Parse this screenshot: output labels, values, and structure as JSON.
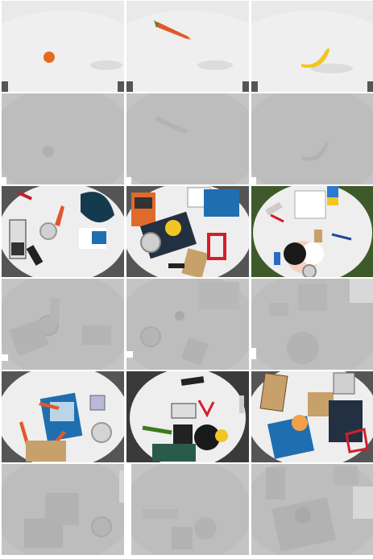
{
  "grid": {
    "columns": 3,
    "rows": 6,
    "cells": [
      {
        "kind": "rgb",
        "scene": "orange"
      },
      {
        "kind": "rgb",
        "scene": "carrot"
      },
      {
        "kind": "rgb",
        "scene": "banana"
      },
      {
        "kind": "depth",
        "scene": "orange"
      },
      {
        "kind": "depth",
        "scene": "carrot"
      },
      {
        "kind": "depth",
        "scene": "banana"
      },
      {
        "kind": "rgb",
        "scene": "clutter-a"
      },
      {
        "kind": "rgb",
        "scene": "clutter-b"
      },
      {
        "kind": "rgb",
        "scene": "clutter-c"
      },
      {
        "kind": "depth",
        "scene": "clutter-a"
      },
      {
        "kind": "depth",
        "scene": "clutter-b"
      },
      {
        "kind": "depth",
        "scene": "clutter-c"
      },
      {
        "kind": "rgb",
        "scene": "clutter-d"
      },
      {
        "kind": "rgb",
        "scene": "clutter-e"
      },
      {
        "kind": "rgb",
        "scene": "clutter-f"
      },
      {
        "kind": "depth",
        "scene": "clutter-d"
      },
      {
        "kind": "depth",
        "scene": "clutter-e"
      },
      {
        "kind": "depth",
        "scene": "clutter-f"
      }
    ]
  },
  "colors": {
    "table_white": "#eeeeee",
    "floor_dark": "#4a4a4a",
    "depth_bg": "#c4c4c4",
    "depth_table": "#bdbdbd",
    "depth_object": "#b0b0b0",
    "orange": "#e66a1a",
    "carrot": "#e2572a",
    "banana": "#f2c522",
    "book_blue": "#1f6fb0",
    "book_dark": "#233042",
    "box_brown": "#c7a06a",
    "red_tool": "#d21f2a"
  }
}
